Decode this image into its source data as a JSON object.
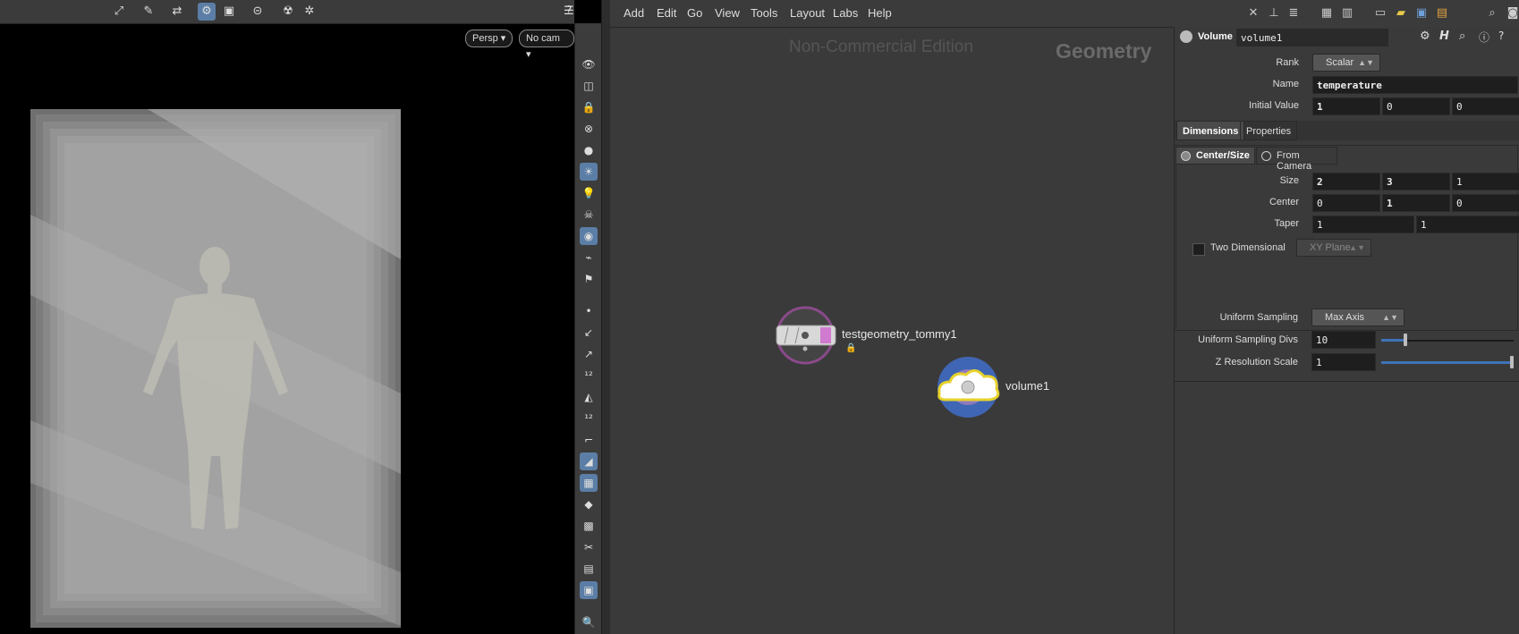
{
  "viewport": {
    "camera_persp": "Persp",
    "camera_nocam": "No cam",
    "toolbar_icons": [
      "select-mode-icon",
      "transform-icon",
      "handle-icon",
      "snap-icon",
      "display-icon",
      "ghost-icon",
      "render-icon",
      "settings-icon"
    ],
    "side_icons": [
      "eye-icon",
      "wireframe-icon",
      "lock-icon",
      "hide-icon",
      "shading-icon",
      "light-icon",
      "bulb-icon",
      "skeleton-icon",
      "camera-icon",
      "background-icon",
      "visualizer-icon",
      "point-icon",
      "normal-icon",
      "vector-icon",
      "point-number-icon",
      "prim-icon",
      "prim-number-icon",
      "uv-icon",
      "grid-icon",
      "texture-icon",
      "flatten-icon",
      "bone-icon",
      "cut-icon",
      "display-options-icon",
      "snapshot-icon"
    ]
  },
  "menu": {
    "items": [
      "Add",
      "Edit",
      "Go",
      "View",
      "Tools",
      "Layout",
      "Labs",
      "Help"
    ]
  },
  "network": {
    "watermark": "Non-Commercial Edition",
    "context": "Geometry",
    "nodes": [
      {
        "name": "testgeometry_tommy1"
      },
      {
        "name": "volume1"
      }
    ]
  },
  "params": {
    "node_type": "Volume",
    "node_name": "volume1",
    "rank_label": "Rank",
    "rank_value": "Scalar",
    "name_label": "Name",
    "name_value": "temperature",
    "initial_label": "Initial Value",
    "initial_values": [
      "1",
      "0",
      "0"
    ],
    "tabs": [
      "Dimensions",
      "Properties"
    ],
    "center_size": "Center/Size",
    "from_camera": "From Camera",
    "size_label": "Size",
    "size_values": [
      "2",
      "3",
      "1"
    ],
    "center_label": "Center",
    "center_values": [
      "0",
      "1",
      "0"
    ],
    "taper_label": "Taper",
    "taper_values": [
      "1",
      "1"
    ],
    "two_dim_label": "Two Dimensional",
    "plane_value": "XY Plane",
    "uniform_label": "Uniform Sampling",
    "uniform_value": "Max Axis",
    "divs_label": "Uniform Sampling Divs",
    "divs_value": "10",
    "zres_label": "Z Resolution Scale",
    "zres_value": "1"
  },
  "colors": {
    "accent": "#5b7ea6",
    "volume_node": "#3f66b4",
    "testgeo_ring": "#8a4a8a",
    "slider_fill": "#3e74b8"
  }
}
